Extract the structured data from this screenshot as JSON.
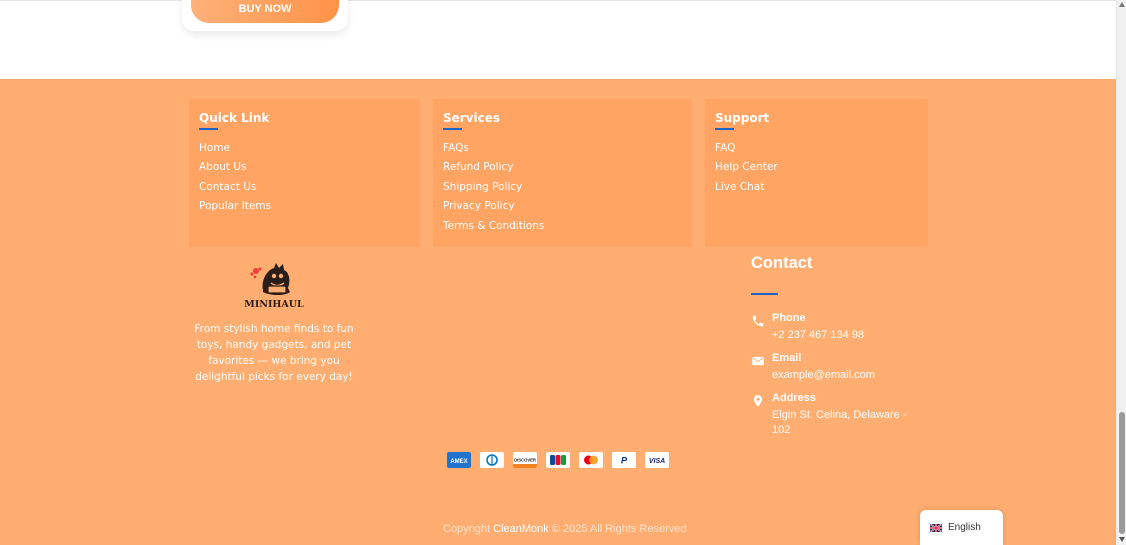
{
  "product": {
    "buy_label": "BUY NOW"
  },
  "footer": {
    "quick_link": {
      "title": "Quick Link",
      "items": [
        "Home",
        "About Us",
        "Contact Us",
        "Popular Items"
      ]
    },
    "services": {
      "title": "Services",
      "items": [
        "FAQs",
        "Refund Policy",
        "Shipping Policy",
        "Privacy Policy",
        "Terms & Conditions"
      ]
    },
    "support": {
      "title": "Support",
      "items": [
        "FAQ",
        "Help Center",
        "Live Chat"
      ]
    },
    "brand": {
      "name": "MINIHAUL",
      "description": "From stylish home finds to fun toys, handy gadgets, and pet favorites — we bring you delightful picks for every day!"
    },
    "contact": {
      "title": "Contact",
      "phone": {
        "label": "Phone",
        "value": "+2 237 467 134 98",
        "icon": "phone-icon"
      },
      "email": {
        "label": "Email",
        "value": "example@email.com",
        "icon": "mail-icon"
      },
      "address": {
        "label": "Address",
        "value": "Elgin St. Celina, Delaware - 102",
        "icon": "location-pin-icon"
      }
    },
    "payments": [
      "american-express",
      "diners-club",
      "discover",
      "jcb",
      "mastercard",
      "paypal",
      "visa"
    ],
    "copyright": {
      "prefix": "Copyright ",
      "brand": "CleanMonk",
      "suffix": " © 2025 All Rights Reserved"
    }
  },
  "language": {
    "label": "English",
    "icon": "uk-flag-icon"
  },
  "colors": {
    "footer_bg": "#ffad70",
    "box_bg": "#ffa463",
    "accent_underline": "#1e63c9",
    "button": "#ff9447"
  }
}
